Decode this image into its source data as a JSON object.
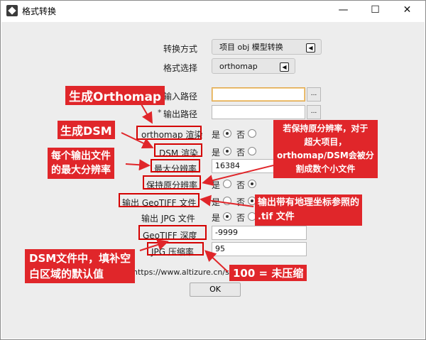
{
  "window": {
    "title": "格式转换",
    "minimize": "—",
    "maximize": "☐",
    "close": "✕"
  },
  "rows": {
    "convert_mode": {
      "label": "转换方式",
      "value": "项目 obj 模型转换"
    },
    "format": {
      "label": "格式选择",
      "value": "orthomap"
    },
    "input_path": {
      "marker": "*",
      "label": "输入路径",
      "value": "",
      "browse": "..."
    },
    "output_path": {
      "marker": "*",
      "label": "输出路径",
      "value": "",
      "browse": "..."
    },
    "orthomap_render": {
      "label": "orthomap 渲染",
      "yes": "是",
      "no": "否",
      "selected": "yes"
    },
    "dsm_render": {
      "label": "DSM 渲染",
      "yes": "是",
      "no": "否",
      "selected": "yes"
    },
    "max_res": {
      "label": "最大分辨率",
      "value": "16384"
    },
    "keep_res": {
      "label": "保持原分辨率",
      "yes": "是",
      "no": "否",
      "selected": "no"
    },
    "geotiff_out": {
      "label": "输出 GeoTIFF 文件",
      "yes": "是",
      "no": "否",
      "selected": "no"
    },
    "jpg_out": {
      "label": "输出 JPG 文件",
      "yes": "是",
      "no": "否",
      "selected": "yes"
    },
    "geotiff_depth": {
      "label": "GeoTIFF 深度",
      "value": "-9999"
    },
    "jpg_quality": {
      "label": "JPG 压缩率",
      "value": "95"
    }
  },
  "url": "https://www.altizure.cn/support/artic",
  "ok": "OK",
  "annotations": {
    "gen_orthomap": "生成Orthomap",
    "gen_dsm": "生成DSM",
    "max_res_1": "每个输出文件",
    "max_res_2": "的最大分辨率",
    "keep_1": "若保持原分辨率，对于",
    "keep_2": "超大项目，",
    "keep_3": "orthomap/DSM会被分",
    "keep_4": "割成数个小文件",
    "geo_1": "输出带有地理坐标参照的",
    "geo_2": ".tif 文件",
    "dsm_1": "DSM文件中，填补空",
    "dsm_2": "白区域的默认值",
    "jpg": "100 = 未压缩"
  },
  "colors": {
    "annotation": "#e0262a",
    "highlight": "#d40000",
    "panel": "#ededed"
  }
}
